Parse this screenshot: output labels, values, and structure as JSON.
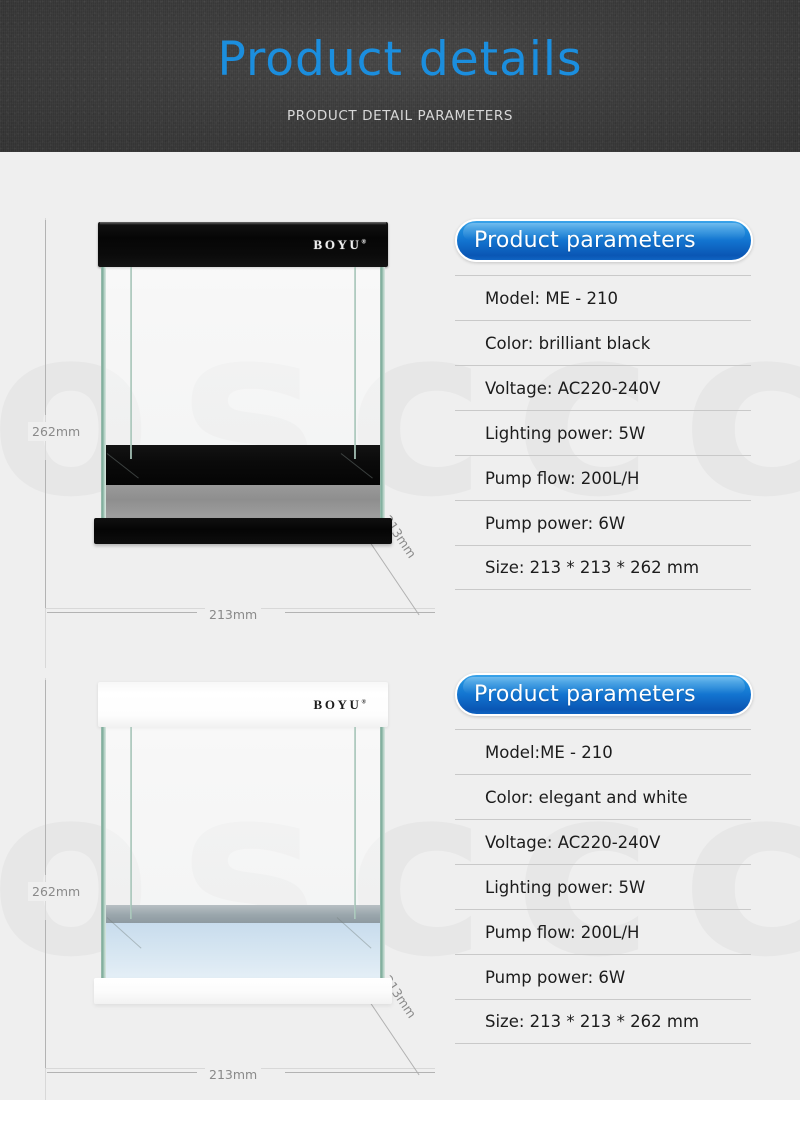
{
  "header": {
    "title": "Product details",
    "subtitle": "PRODUCT DETAIL PARAMETERS",
    "title_color": "#1b8ede",
    "subtitle_color": "#d8d8d8",
    "background_color": "#3c3c3c"
  },
  "watermark": {
    "text": "osccc"
  },
  "products": [
    {
      "brand": "BOYU",
      "variant": "black",
      "hood_color": "#0a0a0a",
      "base_color": "#0a0a0a",
      "dimensions": {
        "height_label": "262mm",
        "width_label": "213mm",
        "depth_label": "213mm"
      },
      "panel": {
        "heading": "Product parameters",
        "accent_color": "#1273cf",
        "specs": [
          "Model: ME - 210",
          "Color: brilliant black",
          "Voltage: AC220-240V",
          "Lighting power: 5W",
          "Pump flow: 200L/H",
          "Pump power: 6W",
          "Size: 213 * 213 * 262 mm"
        ]
      }
    },
    {
      "brand": "BOYU",
      "variant": "white",
      "hood_color": "#ffffff",
      "base_color": "#ffffff",
      "dimensions": {
        "height_label": "262mm",
        "width_label": "213mm",
        "depth_label": "213mm"
      },
      "panel": {
        "heading": "Product parameters",
        "accent_color": "#1273cf",
        "specs": [
          "Model:ME - 210",
          "Color: elegant and white",
          "Voltage: AC220-240V",
          "Lighting power: 5W",
          "Pump flow: 200L/H",
          "Pump power: 6W",
          "Size: 213 * 213 * 262 mm"
        ]
      }
    }
  ]
}
